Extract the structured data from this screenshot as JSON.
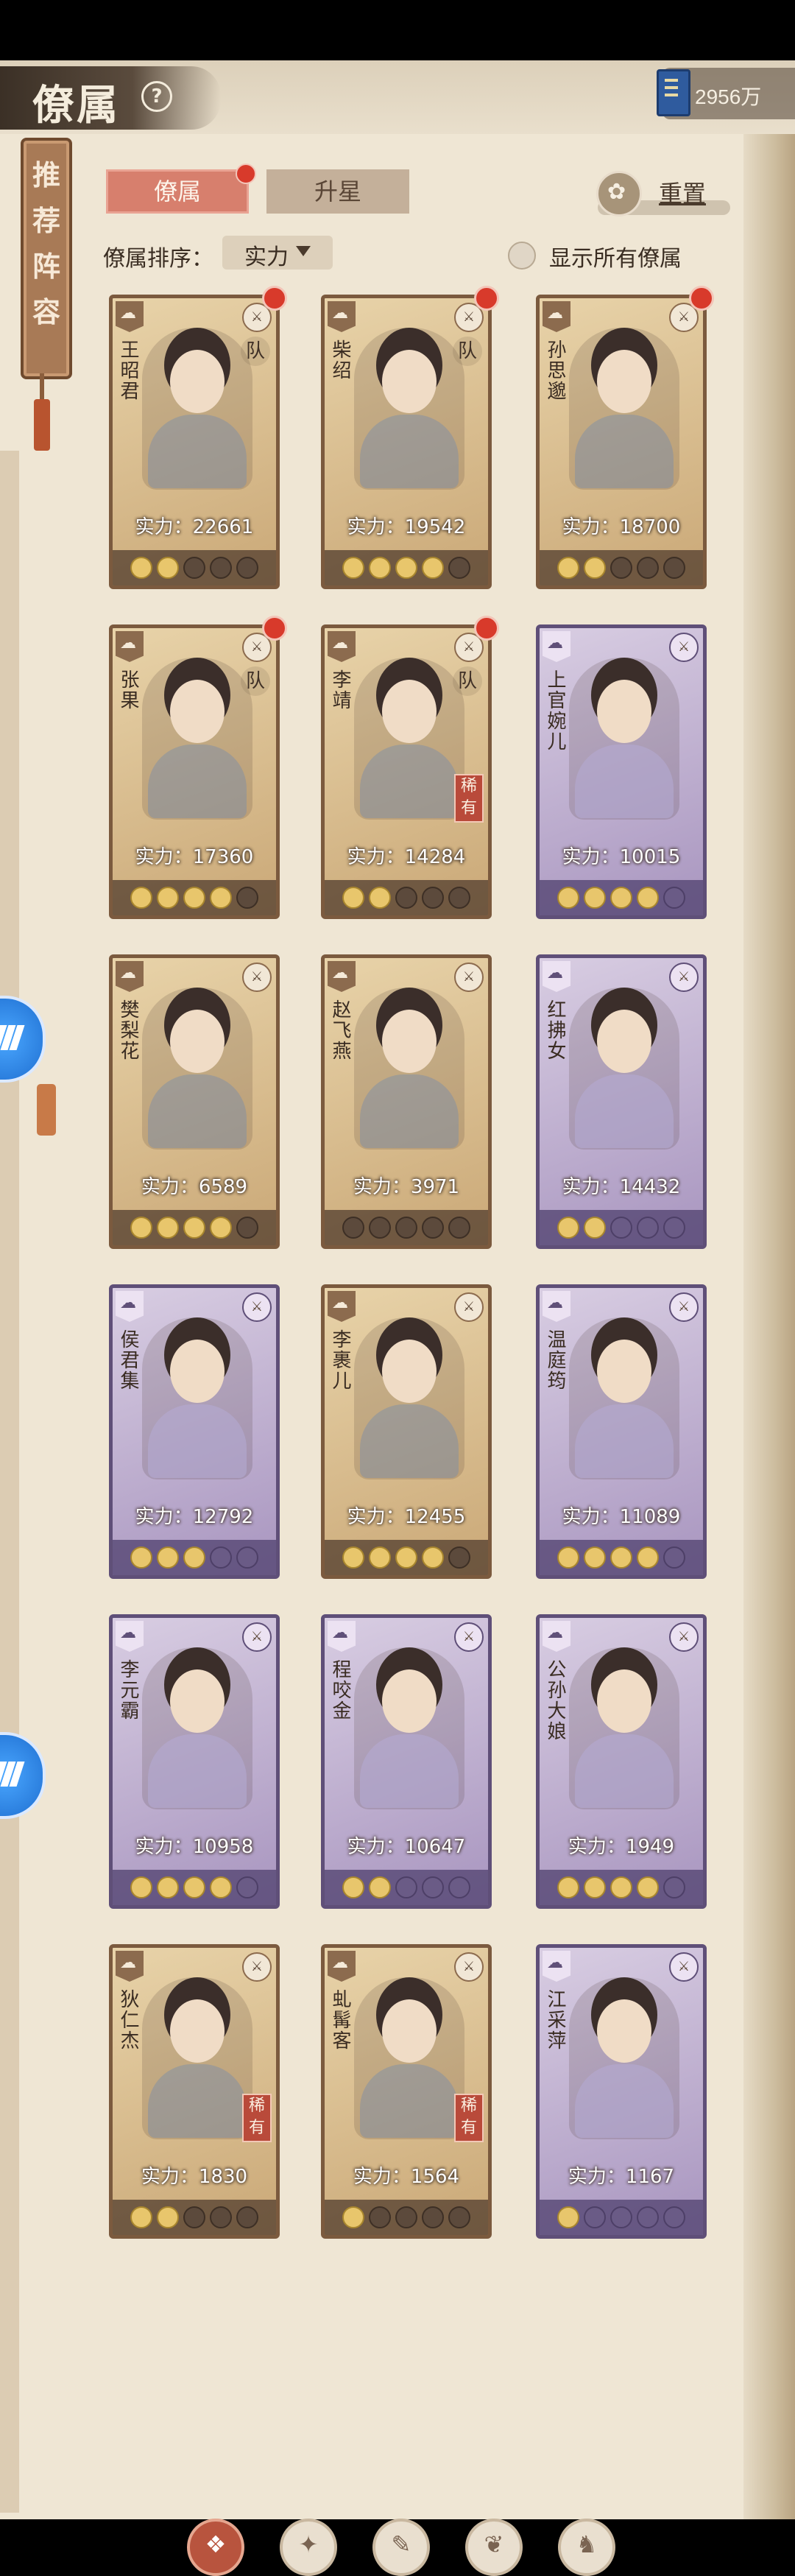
{
  "header": {
    "title": "僚属",
    "help_icon": "?",
    "currency_value": "2956万",
    "currency_icon": "book-icon"
  },
  "sidebar": {
    "recommend_label": "推荐阵容"
  },
  "tabs": [
    {
      "label": "僚属",
      "active": true,
      "badge": true
    },
    {
      "label": "升星",
      "active": false,
      "badge": false
    }
  ],
  "reset_label": "重置",
  "sort": {
    "label": "僚属排序：",
    "value": "实力"
  },
  "show_all_label": "显示所有僚属",
  "cards": [
    {
      "name": "王昭君",
      "power": "实力：22661",
      "team": "队",
      "rare": "",
      "stars": 2,
      "color": "tan",
      "dot": true
    },
    {
      "name": "柴绍",
      "power": "实力：19542",
      "team": "队",
      "rare": "",
      "stars": 4,
      "color": "tan",
      "dot": true
    },
    {
      "name": "孙思邈",
      "power": "实力：18700",
      "team": "",
      "rare": "",
      "stars": 2,
      "color": "tan",
      "dot": true
    },
    {
      "name": "张果",
      "power": "实力：17360",
      "team": "队",
      "rare": "",
      "stars": 4,
      "color": "tan",
      "dot": true
    },
    {
      "name": "李靖",
      "power": "实力：14284",
      "team": "队",
      "rare": "稀有",
      "stars": 2,
      "color": "tan",
      "dot": true
    },
    {
      "name": "上官婉儿",
      "power": "实力：10015",
      "team": "",
      "rare": "",
      "stars": 4,
      "color": "purple",
      "dot": false
    },
    {
      "name": "樊梨花",
      "power": "实力：6589",
      "team": "",
      "rare": "",
      "stars": 4,
      "color": "tan",
      "dot": false
    },
    {
      "name": "赵飞燕",
      "power": "实力：3971",
      "team": "",
      "rare": "",
      "stars": 0,
      "color": "tan",
      "dot": false
    },
    {
      "name": "红拂女",
      "power": "实力：14432",
      "team": "",
      "rare": "",
      "stars": 2,
      "color": "purple",
      "dot": false
    },
    {
      "name": "侯君集",
      "power": "实力：12792",
      "team": "",
      "rare": "",
      "stars": 3,
      "color": "purple",
      "dot": false
    },
    {
      "name": "李裹儿",
      "power": "实力：12455",
      "team": "",
      "rare": "",
      "stars": 4,
      "color": "tan",
      "dot": false
    },
    {
      "name": "温庭筠",
      "power": "实力：11089",
      "team": "",
      "rare": "",
      "stars": 4,
      "color": "purple",
      "dot": false
    },
    {
      "name": "李元霸",
      "power": "实力：10958",
      "team": "",
      "rare": "",
      "stars": 4,
      "color": "purple",
      "dot": false
    },
    {
      "name": "程咬金",
      "power": "实力：10647",
      "team": "",
      "rare": "",
      "stars": 2,
      "color": "purple",
      "dot": false
    },
    {
      "name": "公孙大娘",
      "power": "实力：1949",
      "team": "",
      "rare": "",
      "stars": 4,
      "color": "purple",
      "dot": false
    },
    {
      "name": "狄仁杰",
      "power": "实力：1830",
      "team": "",
      "rare": "稀有",
      "stars": 2,
      "color": "tan",
      "dot": false
    },
    {
      "name": "虬髯客",
      "power": "实力：1564",
      "team": "",
      "rare": "稀有",
      "stars": 1,
      "color": "tan",
      "dot": false
    },
    {
      "name": "江采萍",
      "power": "实力：1167",
      "team": "",
      "rare": "",
      "stars": 1,
      "color": "purple",
      "dot": false
    }
  ]
}
